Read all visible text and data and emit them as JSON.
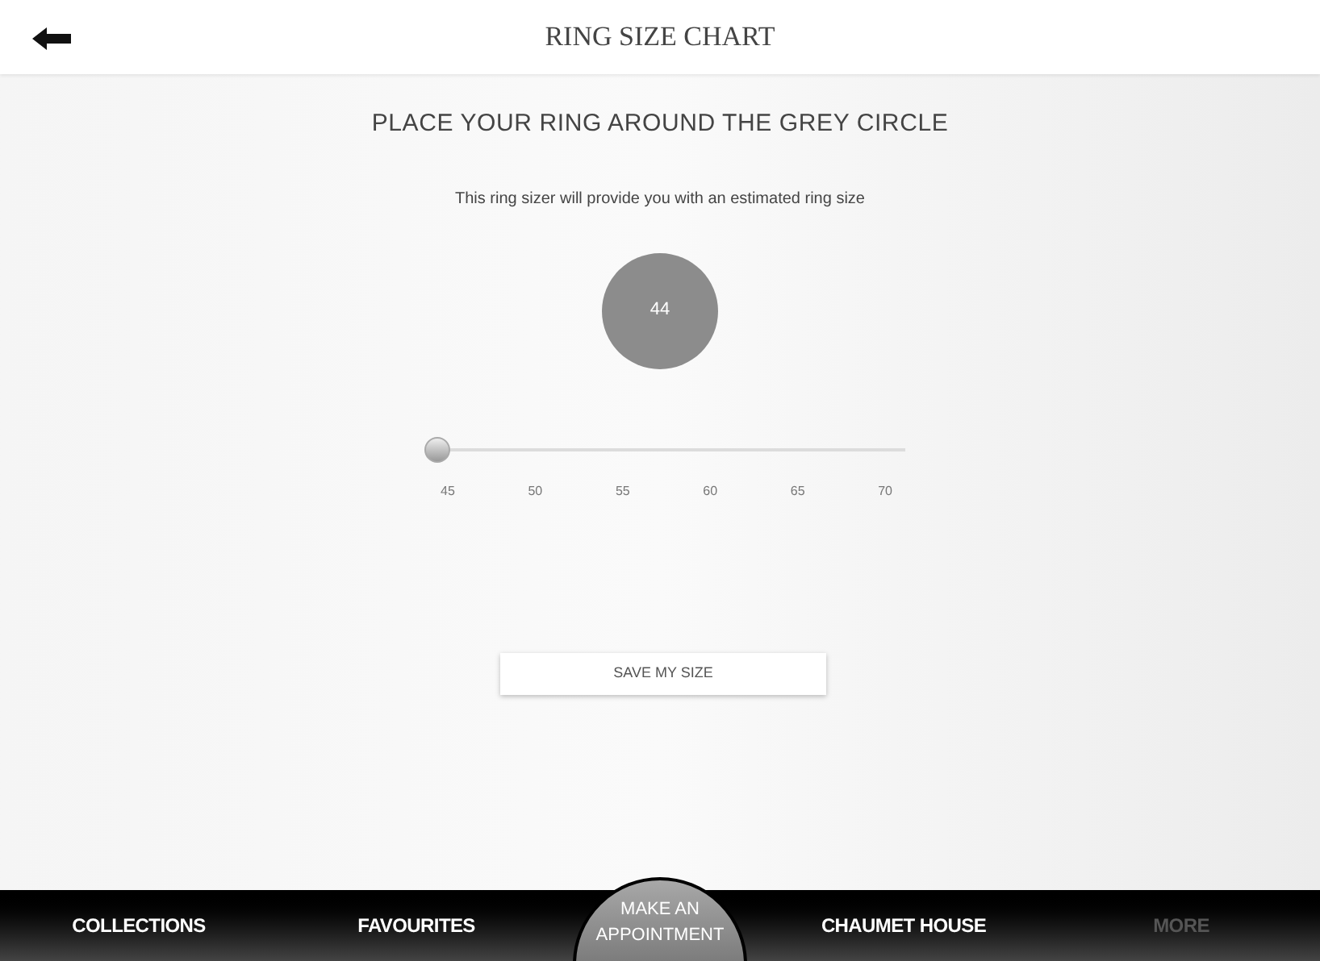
{
  "header": {
    "title": "RING SIZE CHART"
  },
  "heading": "PLACE YOUR RING AROUND THE GREY CIRCLE",
  "subtitle": "This ring sizer will provide you with an estimated ring size",
  "circle": {
    "label": "44"
  },
  "slider": {
    "level": 0,
    "ticks": [
      "45",
      "50",
      "55",
      "60",
      "65",
      "70"
    ]
  },
  "save_button": "SAVE MY SIZE",
  "nav": [
    {
      "label": "COLLECTIONS",
      "kind": "tab",
      "disabled": false
    },
    {
      "label": "FAVOURITES",
      "kind": "tab",
      "disabled": false
    },
    {
      "label": "MAKE AN APPOINTMENT",
      "kind": "center"
    },
    {
      "label": "CHAUMET HOUSE",
      "kind": "tab",
      "disabled": false
    },
    {
      "label": "MORE",
      "kind": "tab",
      "disabled": true
    }
  ]
}
